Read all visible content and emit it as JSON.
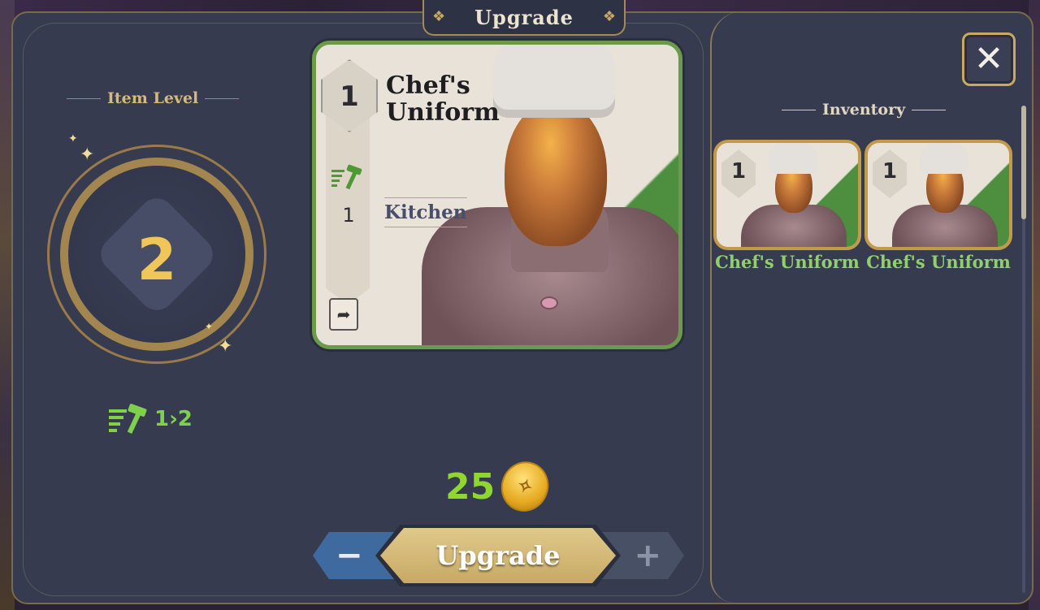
{
  "title": "Upgrade",
  "close_icon": "close-icon",
  "item_level": {
    "label": "Item Level",
    "current": "2",
    "change": "1›2",
    "icon": "hammer-level-icon"
  },
  "card": {
    "level": "1",
    "name": "Chef's Uniform",
    "required_level": "1",
    "category": "Kitchen",
    "hammer_icon": "hammer-icon",
    "equip_icon": "equip-icon"
  },
  "cost": {
    "value": "25",
    "currency_icon": "gold-coin-icon"
  },
  "buttons": {
    "minus": "−",
    "upgrade": "Upgrade",
    "plus": "+"
  },
  "inventory": {
    "label": "Inventory",
    "items": [
      {
        "level": "1",
        "name": "Chef's Uniform"
      },
      {
        "level": "1",
        "name": "Chef's Uniform"
      }
    ]
  },
  "colors": {
    "panel": "#363b4f",
    "gold": "#c9a860",
    "green_text": "#8fd62e",
    "level_number": "#f0c55a"
  }
}
